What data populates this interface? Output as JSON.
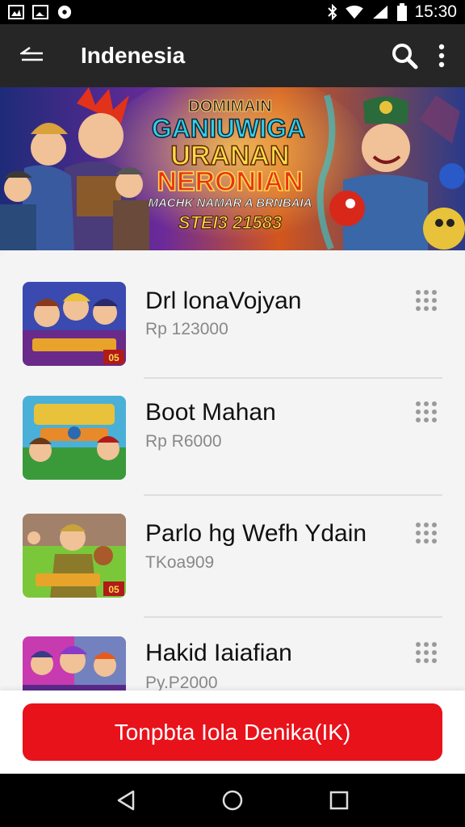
{
  "status_bar": {
    "time": "15:30"
  },
  "app_bar": {
    "title": "Indenesia"
  },
  "banner": {
    "line1": "DOMIMAIN",
    "line2": "GANIUWIGA",
    "line3": "URANAN",
    "line4": "NERONIAN",
    "line5": "MACHK NAMAR A BRNBAIA",
    "line6": "STEI3 21583"
  },
  "items": [
    {
      "title": "Drl lonaVojyan",
      "price": "Rp 123000",
      "badge": "05"
    },
    {
      "title": "Boot Mahan",
      "price": "Rp R6000",
      "badge": ""
    },
    {
      "title": "Parlo hg Wefh Ydain",
      "price": "TKoa909",
      "badge": "05"
    },
    {
      "title": "Hakid Iaiafian",
      "price": "Py.P2000",
      "badge": ""
    }
  ],
  "cta": {
    "label": "Tonpbta Iola Denika(IK)"
  },
  "colors": {
    "accent": "#e8121b",
    "appbar": "#262626"
  }
}
